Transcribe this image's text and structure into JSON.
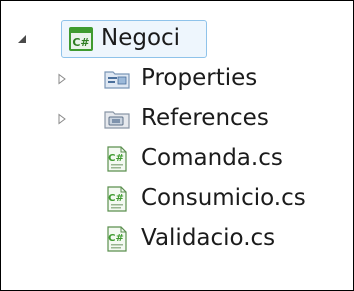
{
  "tree": {
    "project": {
      "label": "Negoci",
      "icon": "csharp-project-icon",
      "expanded": true,
      "selected": true
    },
    "items": [
      {
        "label": "Properties",
        "icon": "properties-folder-icon",
        "expandable": true
      },
      {
        "label": "References",
        "icon": "references-folder-icon",
        "expandable": true
      },
      {
        "label": "Comanda.cs",
        "icon": "csharp-file-icon",
        "expandable": false
      },
      {
        "label": "Consumicio.cs",
        "icon": "csharp-file-icon",
        "expandable": false
      },
      {
        "label": "Validacio.cs",
        "icon": "csharp-file-icon",
        "expandable": false
      }
    ]
  },
  "colors": {
    "selection_border": "#8fc3ea",
    "selection_fill": "#eef6fd",
    "csharp_green": "#3f9b2f",
    "expander_gray": "#5a5a5a",
    "text": "#1b1b1b"
  }
}
